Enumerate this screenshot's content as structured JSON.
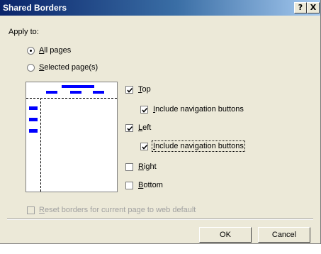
{
  "dialog": {
    "title": "Shared Borders",
    "help_label": "?",
    "close_label": "X"
  },
  "apply_to": {
    "label": "Apply to:",
    "options": [
      {
        "label": "All pages",
        "hotkey": "A",
        "rest": "ll pages",
        "selected": true
      },
      {
        "label": "Selected page(s)",
        "hotkey": "S",
        "rest": "elected page(s)",
        "selected": false
      }
    ]
  },
  "borders": {
    "top": {
      "hotkey": "T",
      "rest": "op",
      "checked": true
    },
    "top_nav": {
      "hotkey": "I",
      "rest": "nclude navigation buttons",
      "checked": true
    },
    "left": {
      "hotkey": "L",
      "rest": "eft",
      "checked": true
    },
    "left_nav": {
      "hotkey": "I",
      "rest": "nclude navigation buttons",
      "checked": true
    },
    "right": {
      "hotkey": "R",
      "rest": "ight",
      "checked": false
    },
    "bottom": {
      "hotkey": "B",
      "rest": "ottom",
      "checked": false
    }
  },
  "reset": {
    "hotkey": "R",
    "rest": "eset borders for current page to web default",
    "checked": false,
    "enabled": false
  },
  "buttons": {
    "ok": "OK",
    "cancel": "Cancel"
  },
  "colors": {
    "nav_buttons": "#0000ff",
    "title_bar": "#0a246a",
    "dialog_bg": "#ece9d8"
  }
}
